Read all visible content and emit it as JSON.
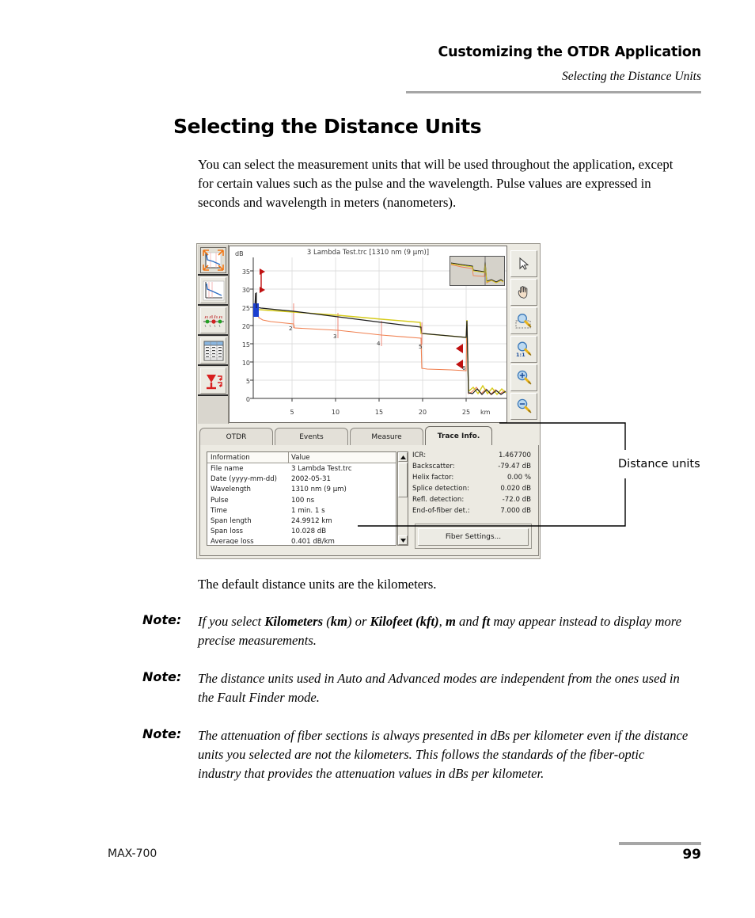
{
  "header": {
    "title": "Customizing the OTDR Application",
    "subtitle": "Selecting the Distance Units"
  },
  "heading": "Selecting the Distance Units",
  "intro_paragraph": "You can select the measurement units that will be used throughout the application, except for certain values such as the pulse and the wavelength. Pulse values are expressed in seconds and wavelength in meters (nanometers).",
  "default_paragraph": "The default distance units are the kilometers.",
  "notes": [
    {
      "label": "Note:",
      "html": "If you select <b>Kilometers</b> (<b>km</b>) or <b>Kilofeet (kft)</b>, <b>m</b> and <b>ft</b> may appear instead to display more precise measurements."
    },
    {
      "label": "Note:",
      "html": "The distance units used in Auto and Advanced modes are independent from the ones used in the Fault Finder mode."
    },
    {
      "label": "Note:",
      "html": "The attenuation of fiber sections is always presented in dBs per kilometer even if the distance units you selected are not the kilometers. This follows the standards of the fiber-optic industry that provides the attenuation values in dBs per kilometer."
    }
  ],
  "callout": {
    "label": "Distance units"
  },
  "footer": {
    "product": "MAX-700",
    "page_number": "99"
  },
  "otdr": {
    "left_toolbar": [
      {
        "name": "full-trace-view-icon",
        "selected": true
      },
      {
        "name": "zoomed-trace-view-icon",
        "selected": false
      },
      {
        "name": "events-map-icon",
        "selected": false
      },
      {
        "name": "events-table-icon",
        "selected": false
      },
      {
        "name": "laser-source-icon",
        "selected": false
      }
    ],
    "right_toolbar": [
      {
        "name": "pointer-tool-icon"
      },
      {
        "name": "pan-hand-tool-icon"
      },
      {
        "name": "zoom-region-tool-icon"
      },
      {
        "name": "zoom-one-to-one-tool-icon",
        "badge": "1:1"
      },
      {
        "name": "zoom-in-tool-icon"
      },
      {
        "name": "zoom-out-tool-icon"
      }
    ],
    "tabs": [
      {
        "label": "OTDR",
        "active": false
      },
      {
        "label": "Events",
        "active": false
      },
      {
        "label": "Measure",
        "active": false
      },
      {
        "label": "Trace Info.",
        "active": true
      }
    ],
    "info_table": {
      "columns": [
        "Information",
        "Value"
      ],
      "rows": [
        {
          "key": "File name",
          "value": "3 Lambda Test.trc"
        },
        {
          "key": "Date (yyyy-mm-dd)",
          "value": "2002-05-31"
        },
        {
          "key": "Wavelength",
          "value": "1310 nm (9 µm)"
        },
        {
          "key": "Pulse",
          "value": "100 ns"
        },
        {
          "key": "Time",
          "value": "1 min. 1 s"
        },
        {
          "key": "Span length",
          "value": "24.9912 km"
        },
        {
          "key": "Span loss",
          "value": "10.028 dB"
        },
        {
          "key": "Average loss",
          "value": "0.401 dB/km"
        }
      ]
    },
    "detail_panel": [
      {
        "key": "ICR:",
        "value": "1.467700"
      },
      {
        "key": "Backscatter:",
        "value": "-79.47 dB"
      },
      {
        "key": "Helix factor:",
        "value": "0.00 %"
      },
      {
        "key": "Splice detection:",
        "value": "0.020 dB"
      },
      {
        "key": "Refl. detection:",
        "value": "-72.0 dB"
      },
      {
        "key": "End-of-fiber det.:",
        "value": "7.000 dB"
      }
    ],
    "fiber_settings_button": "Fiber Settings..."
  },
  "chart_data": {
    "type": "line",
    "title": "3 Lambda Test.trc [1310 nm (9 µm)]",
    "xlabel": "km",
    "ylabel": "dB",
    "xlim": [
      0,
      27.5
    ],
    "ylim": [
      0,
      37
    ],
    "xticks": [
      5,
      10,
      15,
      20,
      25
    ],
    "yticks": [
      0,
      5,
      10,
      15,
      20,
      25,
      30,
      35
    ],
    "grid": true,
    "legend": "none",
    "event_markers": [
      {
        "label": "2",
        "x": 5.2
      },
      {
        "label": "3",
        "x": 10.4
      },
      {
        "label": "4",
        "x": 15.6
      },
      {
        "label": "5",
        "x": 20.6
      },
      {
        "label": "6",
        "x": 25.1
      }
    ],
    "series": [
      {
        "name": "trace-black",
        "color": "#1a1a1a",
        "points": [
          [
            0.15,
            24.9
          ],
          [
            0.2,
            29.0
          ],
          [
            0.35,
            24.9
          ],
          [
            1.0,
            24.6
          ],
          [
            5.2,
            23.0
          ],
          [
            10.4,
            21.4
          ],
          [
            15.6,
            19.9
          ],
          [
            20.5,
            18.2
          ],
          [
            20.6,
            16.5
          ],
          [
            25.0,
            15.2
          ],
          [
            25.1,
            21.3
          ],
          [
            25.3,
            1.6
          ],
          [
            25.8,
            1.4
          ],
          [
            26.4,
            2.0
          ],
          [
            27.0,
            1.2
          ],
          [
            27.4,
            1.8
          ]
        ]
      },
      {
        "name": "trace-yellow",
        "color": "#d6cb1a",
        "points": [
          [
            0.15,
            24.4
          ],
          [
            1.0,
            24.2
          ],
          [
            5.2,
            23.2
          ],
          [
            10.4,
            22.2
          ],
          [
            15.6,
            21.0
          ],
          [
            20.4,
            20.1
          ],
          [
            20.6,
            17.4
          ],
          [
            25.0,
            16.0
          ],
          [
            25.1,
            21.6
          ],
          [
            25.3,
            2.2
          ],
          [
            25.9,
            1.6
          ],
          [
            26.5,
            2.4
          ],
          [
            27.0,
            1.4
          ],
          [
            27.4,
            2.1
          ]
        ]
      },
      {
        "name": "trace-orange",
        "color": "#f08050",
        "points": [
          [
            0.15,
            24.8
          ],
          [
            0.6,
            22.6
          ],
          [
            1.5,
            22.0
          ],
          [
            5.2,
            21.2
          ],
          [
            5.3,
            20.2
          ],
          [
            10.4,
            19.6
          ],
          [
            15.6,
            18.4
          ],
          [
            20.4,
            17.6
          ],
          [
            20.6,
            10.6
          ],
          [
            25.0,
            10.3
          ],
          [
            25.1,
            19.0
          ],
          [
            25.4,
            1.0
          ],
          [
            26.0,
            1.8
          ],
          [
            26.6,
            1.0
          ],
          [
            27.4,
            1.6
          ]
        ]
      }
    ]
  }
}
